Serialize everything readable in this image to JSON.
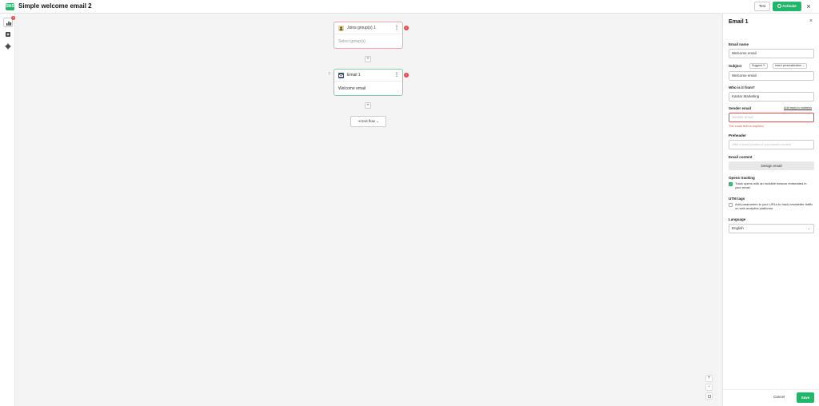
{
  "header": {
    "logo_text": "SMS",
    "title": "Simple welcome email 2",
    "test_label": "Test",
    "activate_label": "Activate",
    "close_symbol": "×"
  },
  "sidebar": {
    "items": [
      {
        "icon": "bar-chart-icon",
        "badge": "1",
        "active": true
      },
      {
        "icon": "add-square-icon",
        "active": false
      },
      {
        "icon": "gear-icon",
        "active": false
      }
    ]
  },
  "flow": {
    "trigger_node": {
      "title": "Joins group(s) 1",
      "body": "Select group(s)",
      "error": "!"
    },
    "email_node": {
      "title": "Email 1",
      "body": "Welcome email",
      "error": "!"
    },
    "add_symbol": "+",
    "exit_label": "Exit flow",
    "drag_symbol": "⠿",
    "kebab_symbol": "⋮"
  },
  "zoom": {
    "in": "+",
    "out": "−"
  },
  "panel": {
    "title": "Email 1",
    "close_symbol": "×",
    "email_name_label": "Email name",
    "email_name_value": "Welcome email",
    "subject_label": "Subject",
    "suggest_label": "Suggest ✎",
    "insert_personalization_label": "Insert personalization ⌄",
    "subject_value": "Welcome email",
    "from_label": "Who is it from?",
    "from_value": "Kantar Marketing",
    "sender_email_label": "Sender email",
    "add_reply_to_label": "Add reply-to address",
    "sender_email_placeholder": "Sender email",
    "sender_email_error": "The email field is required.",
    "preheader_label": "Preheader",
    "preheader_placeholder": "Offer a short preview of your email's content",
    "email_content_label": "Email content",
    "design_email_label": "Design email",
    "opens_tracking_label": "Opens tracking",
    "opens_tracking_text": "Track opens with an invisible beacon embedded in your email.",
    "opens_tracking_checked": true,
    "utm_tags_label": "UTM tags",
    "utm_tags_text": "Add parameters to your URLs to track newsletter traffic on web analytics platforms.",
    "utm_tags_checked": false,
    "language_label": "Language",
    "language_value": "English",
    "cancel_label": "Cancel",
    "save_label": "Save"
  },
  "colors": {
    "brand": "#22b66b",
    "error": "#e84a4a"
  }
}
